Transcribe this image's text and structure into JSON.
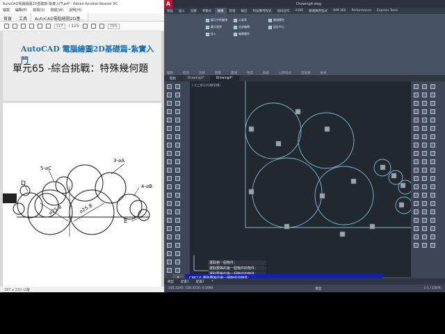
{
  "pdf": {
    "title": "AutoCAD電腦繪圖2D基礎篇-紮實入門.pdf - Adobe Acrobat Reader DC",
    "menu": [
      "檔案",
      "編輯(E)",
      "檢視(V)",
      "視窗(W)",
      "說明(H)"
    ],
    "tabs": {
      "home": "首頁",
      "tools": "工具",
      "document": "AutoCAD電腦繪圖2D基..."
    },
    "toolbar": {
      "page_current": "117",
      "page_total": "/ 125",
      "zoom": "75%"
    },
    "page": {
      "heading": "AutoCAD 電腦繪圖2D基礎篇-紮實入門",
      "subheading": "單元65 -綜合挑戰：特殊幾何題",
      "figure": {
        "label_5c": "5-⌀C",
        "label_3a": "3-⌀A",
        "label_4b": "4-⌀B",
        "label_d": "D",
        "label_e": "E",
        "dim1": "⌀25.8",
        "dim2": "⌀25.8"
      }
    },
    "status": "297 x 210 公釐"
  },
  "cad": {
    "logo": "A",
    "title": "Drawing4.dwg",
    "ribbon_tabs": [
      "預設",
      "插入",
      "註解",
      "參數式",
      "檢視",
      "管理",
      "輸出",
      "附加應用程式",
      "協同合作",
      "A360",
      "精選應用程式",
      "BIM 360",
      "Performance",
      "Express Tools"
    ],
    "ribbon_buttons": [
      "圖元中的圖塊",
      "圖元邊界",
      "插入",
      "公差表",
      "全部編輯",
      "編輯屬性",
      "圖塊屬性",
      "設計中心"
    ],
    "ribbon_groups": [
      "繪製",
      "修改",
      "註解",
      "圖層",
      "圖塊",
      "性質",
      "群組",
      "公用程式",
      "剪貼簿",
      "檢視"
    ],
    "file_tabs": [
      "開始",
      "Drawing3*",
      "Drawing4*"
    ],
    "viewport_label": "[-][上視][2D線架構]",
    "commands": [
      "選取第一個物件：",
      "選取要等的第一個物件的物件：",
      "選取要等的第一個物件的物件："
    ],
    "command_input": "CIRCLE 選取要等的第一個物件的物件：",
    "model_tabs": [
      "模型",
      "配置1",
      "配置2",
      "+"
    ],
    "status_coords": "195.2240, 128.4150, 0.0000",
    "status_mode": "模型",
    "status_scale": "1:1 / 100%"
  },
  "colors": {
    "viewport_bg": "#212830",
    "circle_stroke": "#7cc0d8",
    "line_stroke": "#7cc0d8",
    "grip": "#9ea4ad",
    "command_input_bg": "#1020c0"
  }
}
